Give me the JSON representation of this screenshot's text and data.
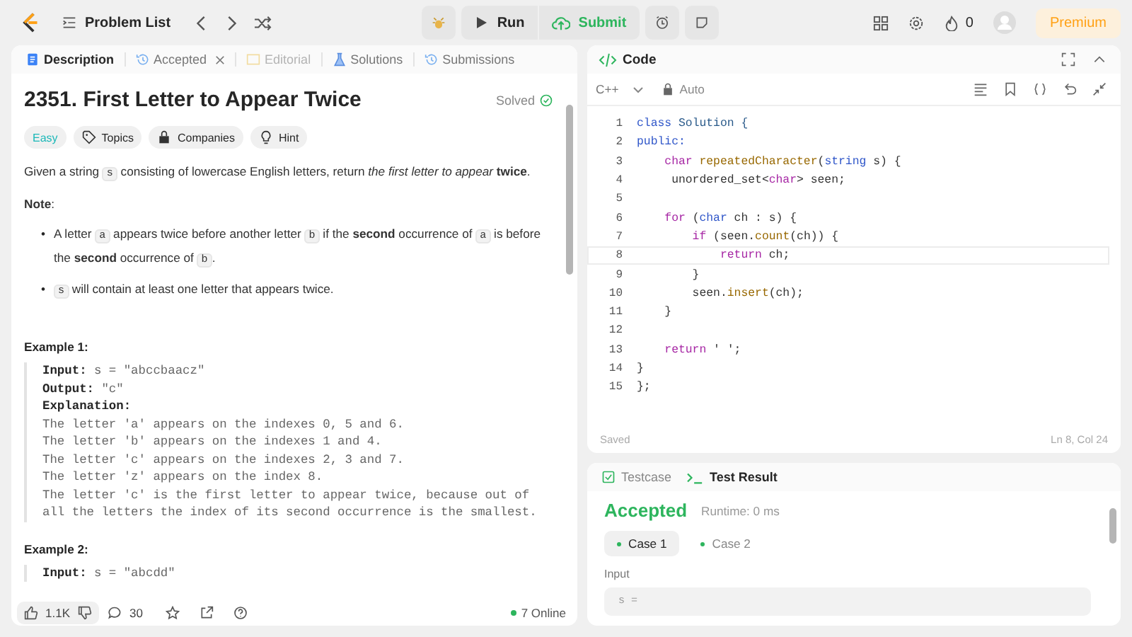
{
  "top_bar": {
    "problem_list": "Problem List",
    "run": "Run",
    "submit": "Submit",
    "streak": "0",
    "premium": "Premium"
  },
  "description_panel": {
    "tabs": [
      {
        "label": "Description",
        "kind": "description",
        "selected": true,
        "disabled": false,
        "closable": false
      },
      {
        "label": "Accepted",
        "kind": "accepted",
        "selected": false,
        "disabled": false,
        "closable": true
      },
      {
        "label": "Editorial",
        "kind": "editorial",
        "selected": false,
        "disabled": true,
        "closable": false
      },
      {
        "label": "Solutions",
        "kind": "solutions",
        "selected": false,
        "disabled": false,
        "closable": false
      },
      {
        "label": "Submissions",
        "kind": "submissions",
        "selected": false,
        "disabled": false,
        "closable": false
      }
    ],
    "title": "2351. First Letter to Appear Twice",
    "status": "Solved",
    "tags": [
      {
        "label": "Easy",
        "kind": "difficulty"
      },
      {
        "label": "Topics",
        "kind": "topics"
      },
      {
        "label": "Companies",
        "kind": "companies"
      },
      {
        "label": "Hint",
        "kind": "hint"
      }
    ],
    "intro": [
      {
        "text": "Given a string ",
        "kind": "text"
      },
      {
        "text": "s",
        "kind": "code"
      },
      {
        "text": " consisting of lowercase English letters, return *the first letter to appear* **twice**.",
        "kind": "text"
      }
    ],
    "note": "**Note**:",
    "constraints": [
      {
        "marker": "•",
        "segments": [
          {
            "text": "A letter ",
            "kind": "text"
          },
          {
            "text": "a",
            "kind": "code"
          },
          {
            "text": " appears twice before another letter ",
            "kind": "text"
          },
          {
            "text": "b",
            "kind": "code"
          },
          {
            "text": " if the **second** occurrence of ",
            "kind": "text"
          },
          {
            "text": "a",
            "kind": "code"
          },
          {
            "text": " is before the **second** occurrence of ",
            "kind": "text"
          },
          {
            "text": "b",
            "kind": "code"
          },
          {
            "text": ".",
            "kind": "text"
          }
        ]
      },
      {
        "marker": "•",
        "segments": [
          {
            "text": "s",
            "kind": "code"
          },
          {
            "text": " will contain at least one letter that appears twice.",
            "kind": "text"
          }
        ]
      }
    ],
    "examples": [
      {
        "heading": "Example 1:",
        "lines": [
          {
            "label": "Input:",
            "text": " s = \"abccbaacz\""
          },
          {
            "label": "Output:",
            "text": " \"c\""
          },
          {
            "label": "Explanation:"
          },
          {
            "text": "The letter 'a' appears on the indexes 0, 5 and 6."
          },
          {
            "text": "The letter 'b' appears on the indexes 1 and 4."
          },
          {
            "text": "The letter 'c' appears on the indexes 2, 3 and 7."
          },
          {
            "text": "The letter 'z' appears on the index 8."
          },
          {
            "text": "The letter 'c' is the first letter to appear twice, because out of"
          },
          {
            "text": "all the letters the index of its second occurrence is the smallest."
          }
        ]
      },
      {
        "heading": "Example 2:",
        "lines": [
          {
            "label": "Input:",
            "text": " s = \"abcdd\""
          }
        ]
      }
    ],
    "footer": {
      "likes": "1.1K",
      "comments": "30",
      "online": "7 Online"
    }
  },
  "code_panel": {
    "title": "Code",
    "language": "C++",
    "mode": "Auto",
    "saved": "Saved",
    "cursor": "Ln 8, Col 24",
    "lines": [
      {
        "number": "1",
        "current": false,
        "tokens": [
          {
            "text": "class",
            "kind": "type"
          },
          {
            "text": " Solution {",
            "kind": "name"
          }
        ]
      },
      {
        "number": "2",
        "current": false,
        "tokens": [
          {
            "text": "public:",
            "kind": "type"
          }
        ]
      },
      {
        "number": "3",
        "current": false,
        "tokens": [
          {
            "text": "    char",
            "kind": "keyword"
          },
          {
            "text": " repeatedCharacter",
            "kind": "function"
          },
          {
            "text": "(",
            "kind": "plain"
          },
          {
            "text": "string",
            "kind": "type"
          },
          {
            "text": " s) {",
            "kind": "plain"
          }
        ]
      },
      {
        "number": "4",
        "current": false,
        "tokens": [
          {
            "text": "     unordered_set<",
            "kind": "plain"
          },
          {
            "text": "char",
            "kind": "keyword"
          },
          {
            "text": "> seen;",
            "kind": "plain"
          }
        ]
      },
      {
        "number": "5",
        "current": false
      },
      {
        "number": "6",
        "current": false,
        "tokens": [
          {
            "text": "    for",
            "kind": "keyword"
          },
          {
            "text": " (",
            "kind": "plain"
          },
          {
            "text": "char",
            "kind": "type"
          },
          {
            "text": " ch : s) {",
            "kind": "plain"
          }
        ]
      },
      {
        "number": "7",
        "current": false,
        "tokens": [
          {
            "text": "        if",
            "kind": "keyword"
          },
          {
            "text": " (seen.",
            "kind": "plain"
          },
          {
            "text": "count",
            "kind": "function"
          },
          {
            "text": "(ch)) {",
            "kind": "plain"
          }
        ]
      },
      {
        "number": "8",
        "current": true,
        "tokens": [
          {
            "text": "            return",
            "kind": "keyword"
          },
          {
            "text": " ch;",
            "kind": "plain"
          }
        ]
      },
      {
        "number": "9",
        "current": false,
        "tokens": [
          {
            "text": "        }",
            "kind": "plain"
          }
        ]
      },
      {
        "number": "10",
        "current": false,
        "tokens": [
          {
            "text": "        seen.",
            "kind": "plain"
          },
          {
            "text": "insert",
            "kind": "function"
          },
          {
            "text": "(ch);",
            "kind": "plain"
          }
        ]
      },
      {
        "number": "11",
        "current": false,
        "tokens": [
          {
            "text": "    }",
            "kind": "plain"
          }
        ]
      },
      {
        "number": "12",
        "current": false
      },
      {
        "number": "13",
        "current": false,
        "tokens": [
          {
            "text": "    return",
            "kind": "keyword"
          },
          {
            "text": " ' ';",
            "kind": "plain"
          }
        ]
      },
      {
        "number": "14",
        "current": false,
        "tokens": [
          {
            "text": "}",
            "kind": "plain"
          }
        ]
      },
      {
        "number": "15",
        "current": false,
        "tokens": [
          {
            "text": "};",
            "kind": "plain"
          }
        ]
      }
    ]
  },
  "result_panel": {
    "tabs": [
      {
        "label": "Testcase",
        "kind": "testcase",
        "selected": false
      },
      {
        "label": "Test Result",
        "kind": "result",
        "selected": true
      }
    ],
    "verdict": "Accepted",
    "runtime": "Runtime: 0 ms",
    "cases": [
      {
        "label": "Case 1",
        "selected": true
      },
      {
        "label": "Case 2",
        "selected": false
      }
    ],
    "input_label": "Input",
    "input_value": "s ="
  }
}
